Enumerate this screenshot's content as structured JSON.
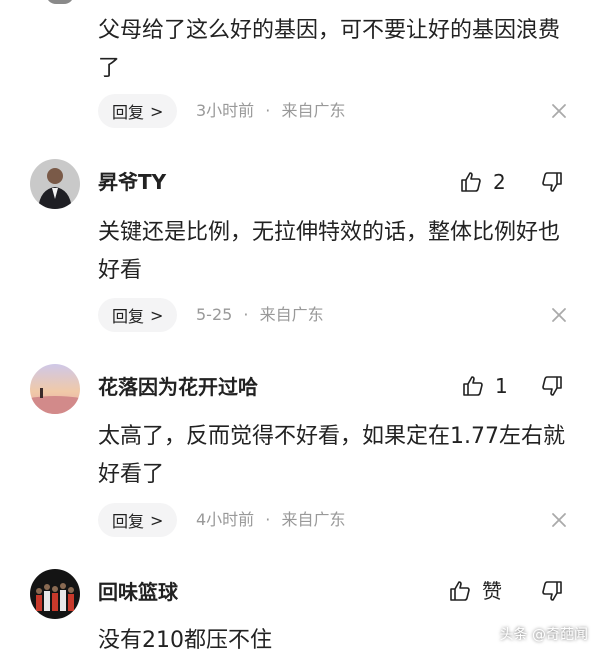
{
  "comments": [
    {
      "username": "",
      "text": "父母给了这么好的基因，可不要让好的基因浪费了",
      "reply_label": "回复",
      "time": "3小时前",
      "separator": "·",
      "location": "来自广东",
      "likes": ""
    },
    {
      "username": "昇爷TY",
      "text": "关键还是比例，无拉伸特效的话，整体比例好也好看",
      "reply_label": "回复",
      "time": "5-25",
      "separator": "·",
      "location": "来自广东",
      "likes": "2",
      "avatar_icon": "man-in-suit-avatar"
    },
    {
      "username": "花落因为花开过哈",
      "text": "太高了，反而觉得不好看，如果定在1.77左右就好看了",
      "reply_label": "回复",
      "time": "4小时前",
      "separator": "·",
      "location": "来自广东",
      "likes": "1",
      "avatar_icon": "sunset-landscape-avatar"
    },
    {
      "username": "回味篮球",
      "text": "没有210都压不住",
      "likes": "赞",
      "avatar_icon": "basketball-team-avatar"
    }
  ],
  "watermark": "头条 @奇葩闻",
  "colors": {
    "text": "#222222",
    "meta": "#999999",
    "reply_bg": "#f4f4f5",
    "background": "#ffffff"
  }
}
